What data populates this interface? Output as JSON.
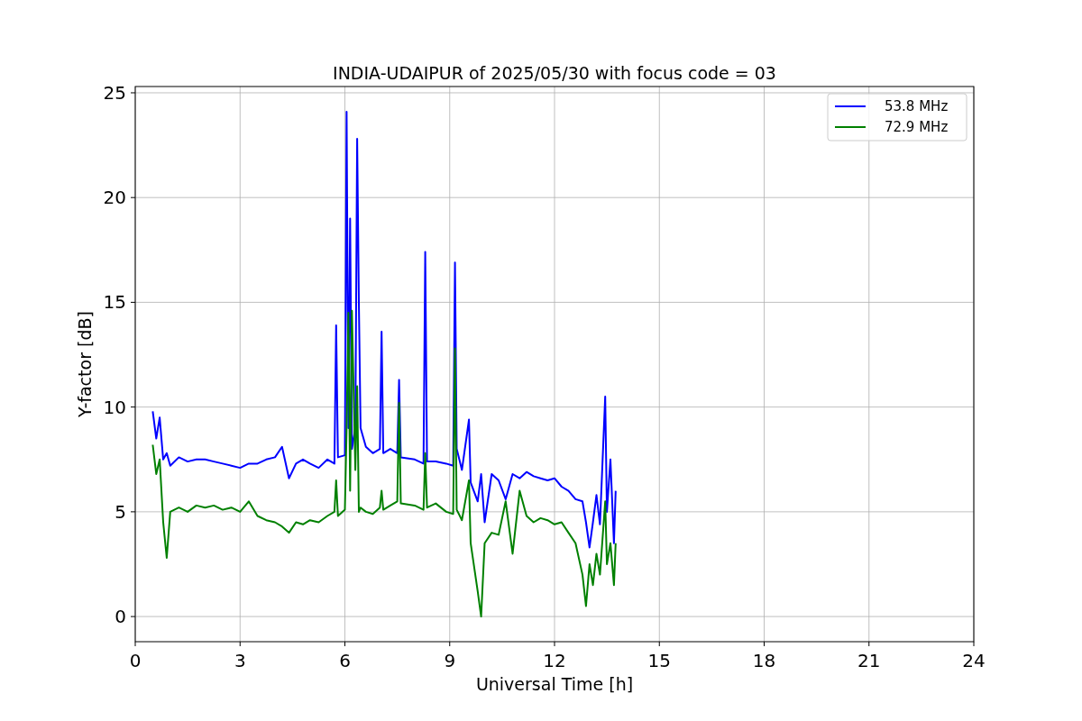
{
  "chart_data": {
    "type": "line",
    "title": "INDIA-UDAIPUR of 2025/05/30 with focus code = 03",
    "xlabel": "Universal Time [h]",
    "ylabel": "Y-factor [dB]",
    "grid": true,
    "legend": true,
    "xlim": [
      0,
      24
    ],
    "ylim": [
      -1.2,
      25.3
    ],
    "xticks": [
      0,
      3,
      6,
      9,
      12,
      15,
      18,
      21,
      24
    ],
    "yticks": [
      0,
      5,
      10,
      15,
      20,
      25
    ],
    "x": [
      0.5,
      0.6,
      0.7,
      0.8,
      0.9,
      1.0,
      1.25,
      1.5,
      1.75,
      2.0,
      2.25,
      2.5,
      2.75,
      3.0,
      3.25,
      3.5,
      3.75,
      4.0,
      4.2,
      4.4,
      4.6,
      4.8,
      5.0,
      5.25,
      5.5,
      5.7,
      5.75,
      5.8,
      6.0,
      6.05,
      6.1,
      6.15,
      6.2,
      6.3,
      6.35,
      6.4,
      6.45,
      6.6,
      6.8,
      7.0,
      7.05,
      7.1,
      7.3,
      7.5,
      7.55,
      7.6,
      8.0,
      8.25,
      8.3,
      8.35,
      8.6,
      8.9,
      9.1,
      9.15,
      9.2,
      9.35,
      9.55,
      9.6,
      9.8,
      9.9,
      10.0,
      10.2,
      10.4,
      10.6,
      10.8,
      11.0,
      11.2,
      11.4,
      11.6,
      11.8,
      12.0,
      12.2,
      12.4,
      12.6,
      12.8,
      12.9,
      13.0,
      13.1,
      13.2,
      13.3,
      13.45,
      13.5,
      13.6,
      13.7,
      13.75
    ],
    "series": [
      {
        "name": "53.8 MHz",
        "color": "#0000ff",
        "values": [
          9.8,
          8.5,
          9.5,
          7.5,
          7.8,
          7.2,
          7.6,
          7.4,
          7.5,
          7.5,
          7.4,
          7.3,
          7.2,
          7.1,
          7.3,
          7.3,
          7.5,
          7.6,
          8.1,
          6.6,
          7.3,
          7.5,
          7.3,
          7.1,
          7.5,
          7.3,
          13.9,
          7.6,
          7.7,
          24.1,
          9,
          19,
          8,
          9,
          22.8,
          15,
          9,
          8.1,
          7.8,
          8,
          13.6,
          7.8,
          8,
          7.8,
          11.3,
          7.6,
          7.5,
          7.3,
          17.4,
          7.4,
          7.4,
          7.3,
          7.2,
          16.9,
          8,
          7,
          9.4,
          6.4,
          5.5,
          6.8,
          4.5,
          6.8,
          6.5,
          5.6,
          6.8,
          6.6,
          6.9,
          6.7,
          6.6,
          6.5,
          6.6,
          6.2,
          6,
          5.6,
          5.5,
          4.5,
          3.3,
          4.5,
          5.8,
          4.4,
          10.5,
          5,
          7.5,
          3.5,
          6
        ]
      },
      {
        "name": "72.9 MHz",
        "color": "#008000",
        "values": [
          8.2,
          6.8,
          7.5,
          4.5,
          2.8,
          5,
          5.2,
          5,
          5.3,
          5.2,
          5.3,
          5.1,
          5.2,
          5,
          5.5,
          4.8,
          4.6,
          4.5,
          4.3,
          4,
          4.5,
          4.4,
          4.6,
          4.5,
          4.8,
          5,
          6.5,
          4.8,
          5.1,
          9,
          14.5,
          6,
          14.6,
          7,
          11,
          5,
          5.2,
          5,
          4.9,
          5.2,
          6,
          5.1,
          5.3,
          5.5,
          10.2,
          5.4,
          5.3,
          5.1,
          7.8,
          5.2,
          5.4,
          5,
          4.9,
          12.8,
          5.1,
          4.6,
          6.5,
          3.5,
          1.2,
          0,
          3.5,
          4,
          3.9,
          5.5,
          3,
          6,
          4.8,
          4.5,
          4.7,
          4.6,
          4.4,
          4.5,
          4,
          3.5,
          2,
          0.5,
          2.5,
          1.5,
          3,
          2,
          5.5,
          2.5,
          3.5,
          1.5,
          3.5
        ]
      }
    ]
  }
}
